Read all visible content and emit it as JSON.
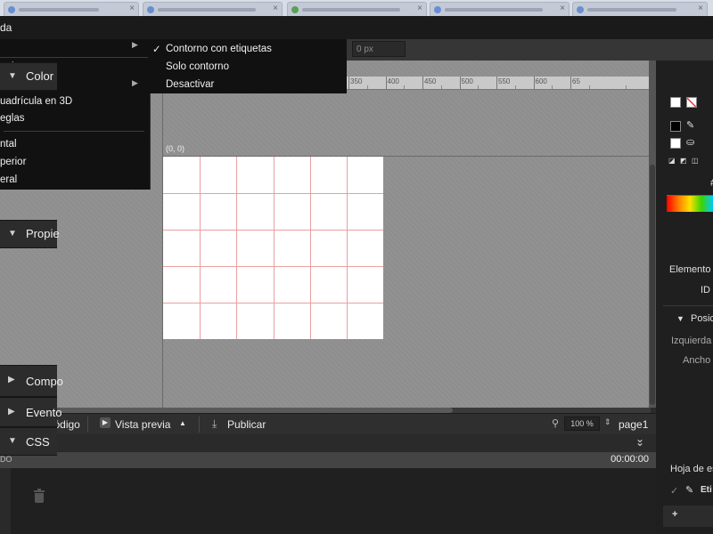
{
  "browser_tabs": [
    {
      "title": ""
    },
    {
      "title": ""
    },
    {
      "title": ""
    },
    {
      "title": ""
    },
    {
      "title": ""
    }
  ],
  "menubar": {
    "label": "da"
  },
  "toolbar": {
    "zoom_field": "0 px"
  },
  "main_menu": {
    "items": [
      {
        "label": "ento",
        "has_submenu": false
      },
      {
        "label": "a",
        "has_submenu": true
      },
      {
        "label": "uadrícula en 3D",
        "has_submenu": false
      },
      {
        "label": "eglas",
        "has_submenu": false
      },
      {
        "label": "ntal",
        "has_submenu": false
      },
      {
        "label": "perior",
        "has_submenu": false
      },
      {
        "label": "eral",
        "has_submenu": false
      }
    ]
  },
  "sub_menu": {
    "items": [
      {
        "label": "Contorno con etiquetas",
        "checked": true
      },
      {
        "label": "Solo contorno",
        "checked": false
      },
      {
        "label": "Desactivar",
        "checked": false
      }
    ]
  },
  "ruler": {
    "ticks": [
      "350",
      "400",
      "450",
      "500",
      "550",
      "600",
      "65"
    ]
  },
  "canvas": {
    "origin": "(0, 0)",
    "grid_cols": 6,
    "grid_rows": 5
  },
  "bottombar": {
    "code_view": "Vista de código",
    "preview": "Vista previa",
    "publish": "Publicar",
    "zoom": "100 %",
    "page": "page1"
  },
  "timeline": {
    "label": "DO",
    "time": "00:00:00"
  },
  "right_panel": {
    "color": {
      "title": "Color",
      "hex_prefix": "#"
    },
    "properties": {
      "title": "Propie",
      "element_label": "Elemento",
      "id_label": "ID",
      "position_label": "Posic",
      "left_label": "Izquierda",
      "width_label": "Ancho"
    },
    "components": {
      "title": "Compo"
    },
    "events": {
      "title": "Evento"
    },
    "css": {
      "title": "CSS",
      "stylesheet_label": "Hoja de es",
      "item_label": "Eti",
      "add_label": "+"
    }
  },
  "colors": {
    "menu_bg": "#111111",
    "canvas_bg": "#8e8e8e",
    "grid_line": "#e8a0a0",
    "stage_bg": "#ffffff"
  }
}
